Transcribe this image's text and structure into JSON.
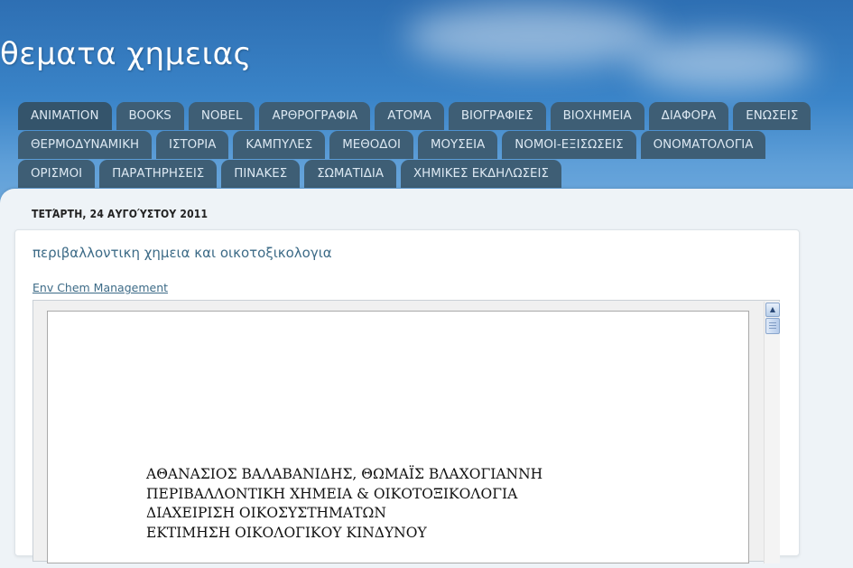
{
  "blog": {
    "title": "θεματα χημειας"
  },
  "nav": {
    "row1": [
      "ANIMATION",
      "BOOKS",
      "NOBEL",
      "ΑΡΘΡΟΓΡΑΦΙΑ",
      "ΑΤΟΜΑ",
      "ΒΙΟΓΡΑΦΙΕΣ",
      "ΒΙΟΧΗΜΕΙΑ",
      "ΔΙΑΦΟΡΑ",
      "ΕΝΩΣΕΙΣ"
    ],
    "row2": [
      "ΘΕΡΜΟΔΥΝΑΜΙΚΗ",
      "ΙΣΤΟΡΙΑ",
      "ΚΑΜΠΥΛΕΣ",
      "ΜΕΘΟΔΟΙ",
      "ΜΟΥΣΕΙΑ",
      "ΝΟΜΟΙ-ΕΞΙΣΩΣΕΙΣ",
      "ΟΝΟΜΑΤΟΛΟΓΙΑ"
    ],
    "row3": [
      "ΟΡΙΣΜΟΙ",
      "ΠΑΡΑΤΗΡΗΣΕΙΣ",
      "ΠΙΝΑΚΕΣ",
      "ΣΩΜΑΤΙΔΙΑ",
      "ΧΗΜΙΚΕΣ ΕΚΔΗΛΩΣΕΙΣ"
    ]
  },
  "post": {
    "date": "ΤΕΤΆΡΤΗ, 24 ΑΥΓΟΎΣΤΟΥ 2011",
    "title": "περιβαλλοντικη χημεια και οικοτοξικολογια",
    "link_text": "Env Chem Management",
    "document_lines": [
      "ΑΘΑΝΑΣΙΟΣ ΒΑΛΑΒΑΝΙΔΗΣ, ΘΩΜΑΪΣ ΒΛΑΧΟΓΙΑΝΝΗ",
      "ΠΕΡΙΒΑΛΛΟΝΤΙΚΗ ΧΗΜΕΙΑ & ΟΙΚΟΤΟΞΙΚΟΛΟΓΙΑ",
      "ΔΙΑΧΕΙΡΙΣΗ ΟΙΚΟΣΥΣΤΗΜΑΤΩΝ",
      "ΕΚΤΙΜΗΣΗ ΟΙΚΟΛΟΓΙΚΟΥ ΚΙΝΔΥΝΟΥ"
    ]
  },
  "colors": {
    "tab_bg": "#3e5e75",
    "tab_text": "#dce8f2",
    "link": "#3d6b87"
  },
  "icons": {
    "scroll_up": "triangle-up-icon"
  }
}
